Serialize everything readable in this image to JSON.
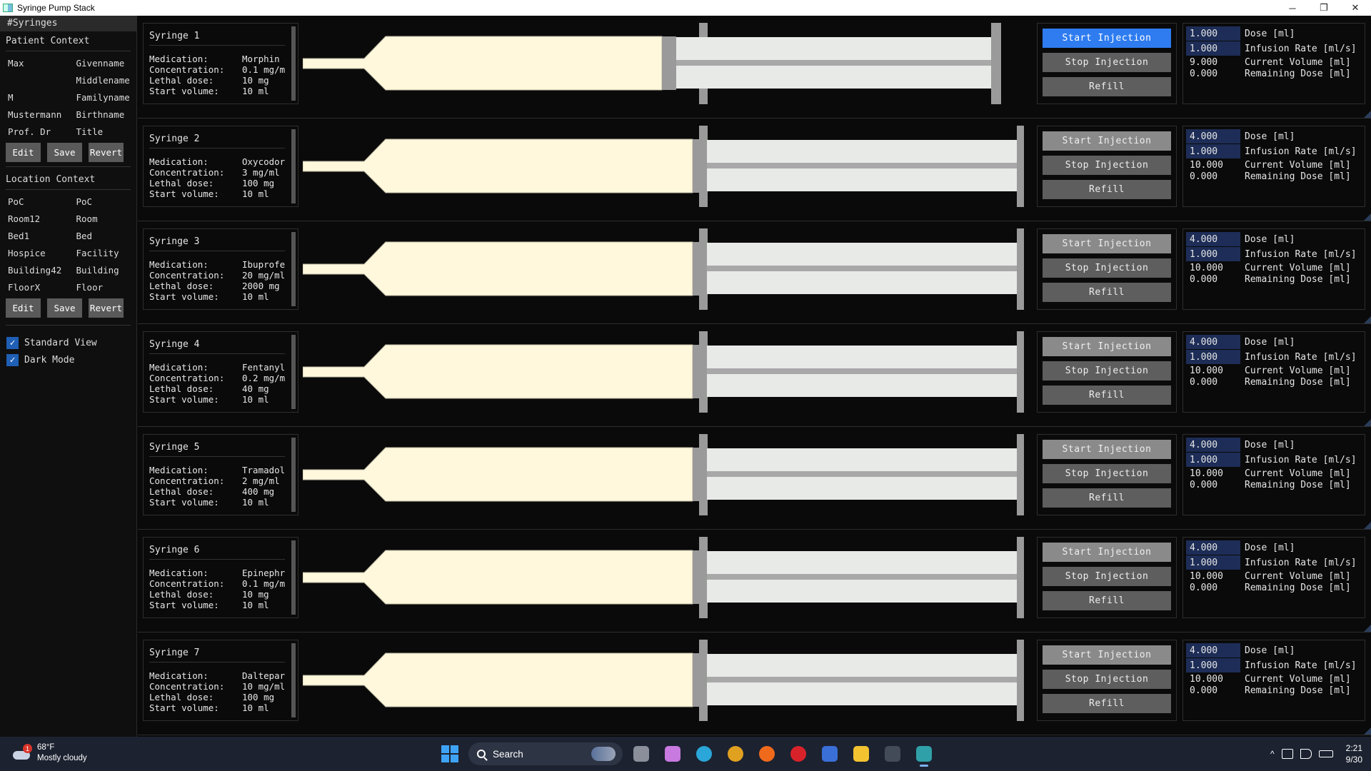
{
  "window": {
    "title": "Syringe Pump Stack",
    "minimize": "─",
    "maximize": "❐",
    "close": "✕"
  },
  "left": {
    "tab": "#Syringes",
    "patient": {
      "title": "Patient Context",
      "rows": [
        {
          "value": "Max",
          "label": "Givenname"
        },
        {
          "value": "",
          "label": "Middlename"
        },
        {
          "value": "M",
          "label": "Familyname"
        },
        {
          "value": "Mustermann",
          "label": "Birthname"
        },
        {
          "value": "Prof. Dr",
          "label": "Title"
        }
      ],
      "buttons": {
        "edit": "Edit",
        "save": "Save",
        "revert": "Revert"
      }
    },
    "location": {
      "title": "Location Context",
      "rows": [
        {
          "value": "PoC",
          "label": "PoC"
        },
        {
          "value": "Room12",
          "label": "Room"
        },
        {
          "value": "Bed1",
          "label": "Bed"
        },
        {
          "value": "Hospice",
          "label": "Facility"
        },
        {
          "value": "Building42",
          "label": "Building"
        },
        {
          "value": "FloorX",
          "label": "Floor"
        }
      ],
      "buttons": {
        "edit": "Edit",
        "save": "Save",
        "revert": "Revert"
      }
    },
    "checks": [
      {
        "label": "Standard View",
        "checked": true,
        "mark": "✓"
      },
      {
        "label": "Dark Mode",
        "checked": true,
        "mark": "✓"
      }
    ]
  },
  "labels": {
    "medication": "Medication:",
    "concentration": "Concentration:",
    "lethal": "Lethal dose:",
    "start_volume": "Start volume:",
    "start_btn": "Start Injection",
    "stop_btn": "Stop Injection",
    "refill_btn": "Refill",
    "dose": "Dose [ml]",
    "rate": "Infusion Rate [ml/s]",
    "current": "Current Volume [ml]",
    "remaining": "Remaining Dose [ml]"
  },
  "syringes": [
    {
      "name": "Syringe 1",
      "medication": "Morphin",
      "concentration": "0.1 mg/m",
      "lethal": "10 mg",
      "start_volume": "10 ml",
      "dose": "1.000",
      "rate": "1.000",
      "current": "9.000",
      "remaining": "0.000",
      "active": true,
      "fill": 0.9
    },
    {
      "name": "Syringe 2",
      "medication": "Oxycodor",
      "concentration": "3 mg/ml",
      "lethal": "100 mg",
      "start_volume": "10 ml",
      "dose": "4.000",
      "rate": "1.000",
      "current": "10.000",
      "remaining": "0.000",
      "active": false,
      "fill": 1.0
    },
    {
      "name": "Syringe 3",
      "medication": "Ibuprofe",
      "concentration": "20 mg/ml",
      "lethal": "2000 mg",
      "start_volume": "10 ml",
      "dose": "4.000",
      "rate": "1.000",
      "current": "10.000",
      "remaining": "0.000",
      "active": false,
      "fill": 1.0
    },
    {
      "name": "Syringe 4",
      "medication": "Fentanyl",
      "concentration": "0.2 mg/m",
      "lethal": "40 mg",
      "start_volume": "10 ml",
      "dose": "4.000",
      "rate": "1.000",
      "current": "10.000",
      "remaining": "0.000",
      "active": false,
      "fill": 1.0
    },
    {
      "name": "Syringe 5",
      "medication": "Tramadol",
      "concentration": "2 mg/ml",
      "lethal": "400 mg",
      "start_volume": "10 ml",
      "dose": "4.000",
      "rate": "1.000",
      "current": "10.000",
      "remaining": "0.000",
      "active": false,
      "fill": 1.0
    },
    {
      "name": "Syringe 6",
      "medication": "Epinephr",
      "concentration": "0.1 mg/m",
      "lethal": "10 mg",
      "start_volume": "10 ml",
      "dose": "4.000",
      "rate": "1.000",
      "current": "10.000",
      "remaining": "0.000",
      "active": false,
      "fill": 1.0
    },
    {
      "name": "Syringe 7",
      "medication": "Daltepar",
      "concentration": "10 mg/ml",
      "lethal": "100 mg",
      "start_volume": "10 ml",
      "dose": "4.000",
      "rate": "1.000",
      "current": "10.000",
      "remaining": "0.000",
      "active": false,
      "fill": 1.0
    }
  ],
  "colors": {
    "fluid": "#fff8dc",
    "plunger": "#e8eae8",
    "stopper": "#9a9a9a",
    "active_button": "#2e7cf0",
    "edit_field": "#1d2d57"
  },
  "taskbar": {
    "weather": {
      "badge": "1",
      "temp": "68°F",
      "desc": "Mostly cloudy"
    },
    "search": "Search",
    "apps": [
      "task-view-icon",
      "copilot-icon",
      "edge-icon",
      "chrome-icon",
      "firefox-icon",
      "opera-icon",
      "vpn-icon",
      "file-explorer-icon",
      "terminal-icon",
      "syringe-pump-app-icon"
    ],
    "tray_caret": "^",
    "time": "2:21",
    "date": "9/30"
  }
}
